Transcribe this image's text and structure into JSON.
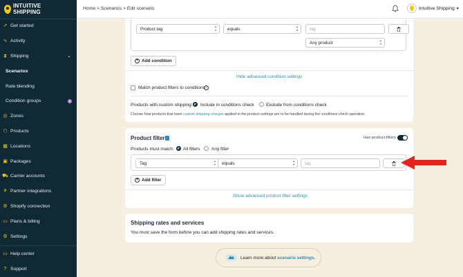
{
  "brand": {
    "line1": "INTUITIVE",
    "line2": "SHIPPING"
  },
  "sidebar": {
    "items": [
      {
        "label": "Get started",
        "icon": "rocket-icon",
        "glyph": "➚"
      },
      {
        "label": "Activity",
        "icon": "activity-icon",
        "glyph": "∿"
      },
      {
        "label": "Shipping",
        "icon": "shipping-icon",
        "glyph": "⧗",
        "expanded": true
      },
      {
        "label": "Scenarios",
        "sub": true,
        "active": true
      },
      {
        "label": "Rate blending",
        "sub": true
      },
      {
        "label": "Condition groups",
        "sub": true,
        "badge": "1"
      },
      {
        "label": "Zones",
        "icon": "zones-icon",
        "glyph": "◎"
      },
      {
        "label": "Products",
        "icon": "products-icon",
        "glyph": "⬡"
      },
      {
        "label": "Locations",
        "icon": "locations-icon",
        "glyph": "▦"
      },
      {
        "label": "Packages",
        "icon": "packages-icon",
        "glyph": "▣"
      },
      {
        "label": "Carrier accounts",
        "icon": "carrier-icon",
        "glyph": "⛟"
      },
      {
        "label": "Partner integrations",
        "icon": "partner-icon",
        "glyph": "⚘"
      },
      {
        "label": "Shopify connection",
        "icon": "shopify-icon",
        "glyph": "⚙"
      },
      {
        "label": "Plans & billing",
        "icon": "billing-icon",
        "glyph": "▭"
      },
      {
        "label": "Settings",
        "icon": "settings-icon",
        "glyph": "⚙"
      }
    ],
    "bottom": [
      {
        "label": "Help center",
        "icon": "help-center-icon",
        "glyph": "▭"
      },
      {
        "label": "Support",
        "icon": "support-icon",
        "glyph": "?"
      }
    ]
  },
  "topbar": {
    "breadcrumb": "Home > Scenarios > Edit scenario",
    "user": "Intuitive Shipping",
    "user_caret": "▾"
  },
  "conditions": {
    "field": "Product tag",
    "operator": "equals",
    "value_placeholder": "tag",
    "scope": "Any product",
    "add_label": "Add condition",
    "hide_advanced": "Hide advanced condition settings",
    "match_filters": "Match product filters to conditions",
    "custom_shipping_label": "Products with custom shipping:",
    "include_label": "Include in conditions check",
    "exclude_label": "Exclude from conditions check",
    "note_prefix": "Choose how products that have ",
    "note_link": "custom shipping charges",
    "note_suffix": " applied in the product settings are to be handled during the conditions check operation."
  },
  "product_filters": {
    "title": "Product filters",
    "toggle_label": "Has product filters",
    "must_match": "Products must match:",
    "all_label": "All filters",
    "any_label": "Any filter",
    "field": "Tag",
    "operator": "equals",
    "value_placeholder": "tag",
    "add_label": "Add filter",
    "show_advanced": "Show advanced product filter settings"
  },
  "rates": {
    "title": "Shipping rates and services",
    "message": "You must save the form before you can add shipping rates and services."
  },
  "learn": {
    "prefix": "Learn more about ",
    "link": "scenario settings."
  },
  "colors": {
    "sidebar": "#0f2a35",
    "accent": "#f5c518",
    "link": "#2a8fb0",
    "page_bg": "#f6efe0",
    "annotation_arrow": "#e8231f"
  }
}
